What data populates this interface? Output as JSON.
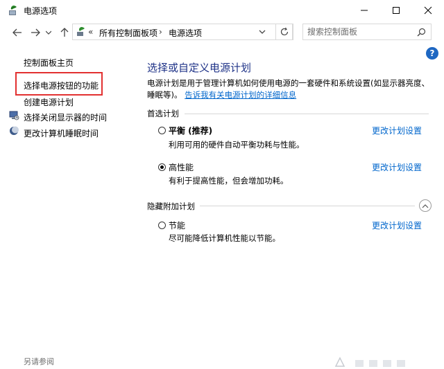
{
  "window": {
    "title": "电源选项"
  },
  "address": {
    "overflow": "«",
    "crumbs": [
      "所有控制面板项",
      "电源选项"
    ],
    "separator": "›"
  },
  "search": {
    "placeholder": "搜索控制面板"
  },
  "sidebar": {
    "items": [
      {
        "label": "控制面板主页"
      },
      {
        "label": "选择电源按钮的功能"
      },
      {
        "label": "创建电源计划"
      },
      {
        "label": "选择关闭显示器的时间"
      },
      {
        "label": "更改计算机睡眠时间"
      }
    ],
    "see_also": "另请参阅"
  },
  "main": {
    "help": "?",
    "title": "选择或自定义电源计划",
    "description": "电源计划是用于管理计算机如何使用电源的一套硬件和系统设置(如显示器亮度、睡眠等)。",
    "description_link": "告诉我有关电源计划的详细信息",
    "preferred_label": "首选计划",
    "hidden_label": "隐藏附加计划",
    "plans": [
      {
        "name": "平衡 (推荐)",
        "desc": "利用可用的硬件自动平衡功耗与性能。",
        "link": "更改计划设置",
        "selected": false
      },
      {
        "name": "高性能",
        "desc": "有利于提高性能，但会增加功耗。",
        "link": "更改计划设置",
        "selected": true
      },
      {
        "name": "节能",
        "desc": "尽可能降低计算机性能以节能。",
        "link": "更改计划设置",
        "selected": false
      }
    ]
  },
  "colors": {
    "accent_link": "#0066cc",
    "title_blue": "#1e3287",
    "highlight_red": "#e23030"
  }
}
